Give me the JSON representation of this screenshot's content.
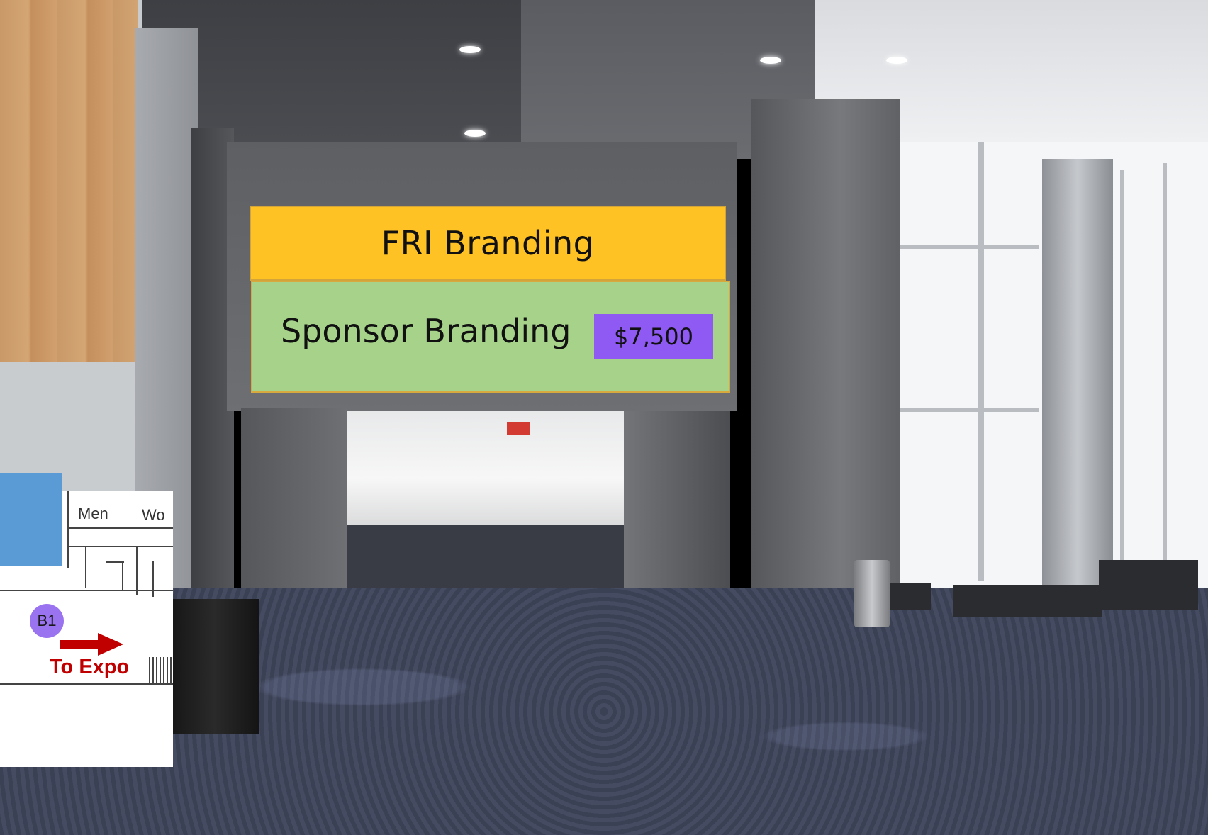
{
  "banners": {
    "top_label": "FRI Branding",
    "sponsor_label": "Sponsor Branding",
    "price": "$7,500"
  },
  "map": {
    "room_label_men": "Men",
    "room_label_women_partial": "Wo",
    "booth_marker": "B1",
    "direction_label": "To Expo"
  },
  "colors": {
    "fri_banner": "#fec224",
    "sponsor_banner": "#a6d389",
    "price_badge": "#8f5af4",
    "booth_marker": "#9a73f0",
    "arrow": "#c00000",
    "map_block": "#5b9bd5"
  },
  "icons": [
    "arrow-right-icon"
  ]
}
